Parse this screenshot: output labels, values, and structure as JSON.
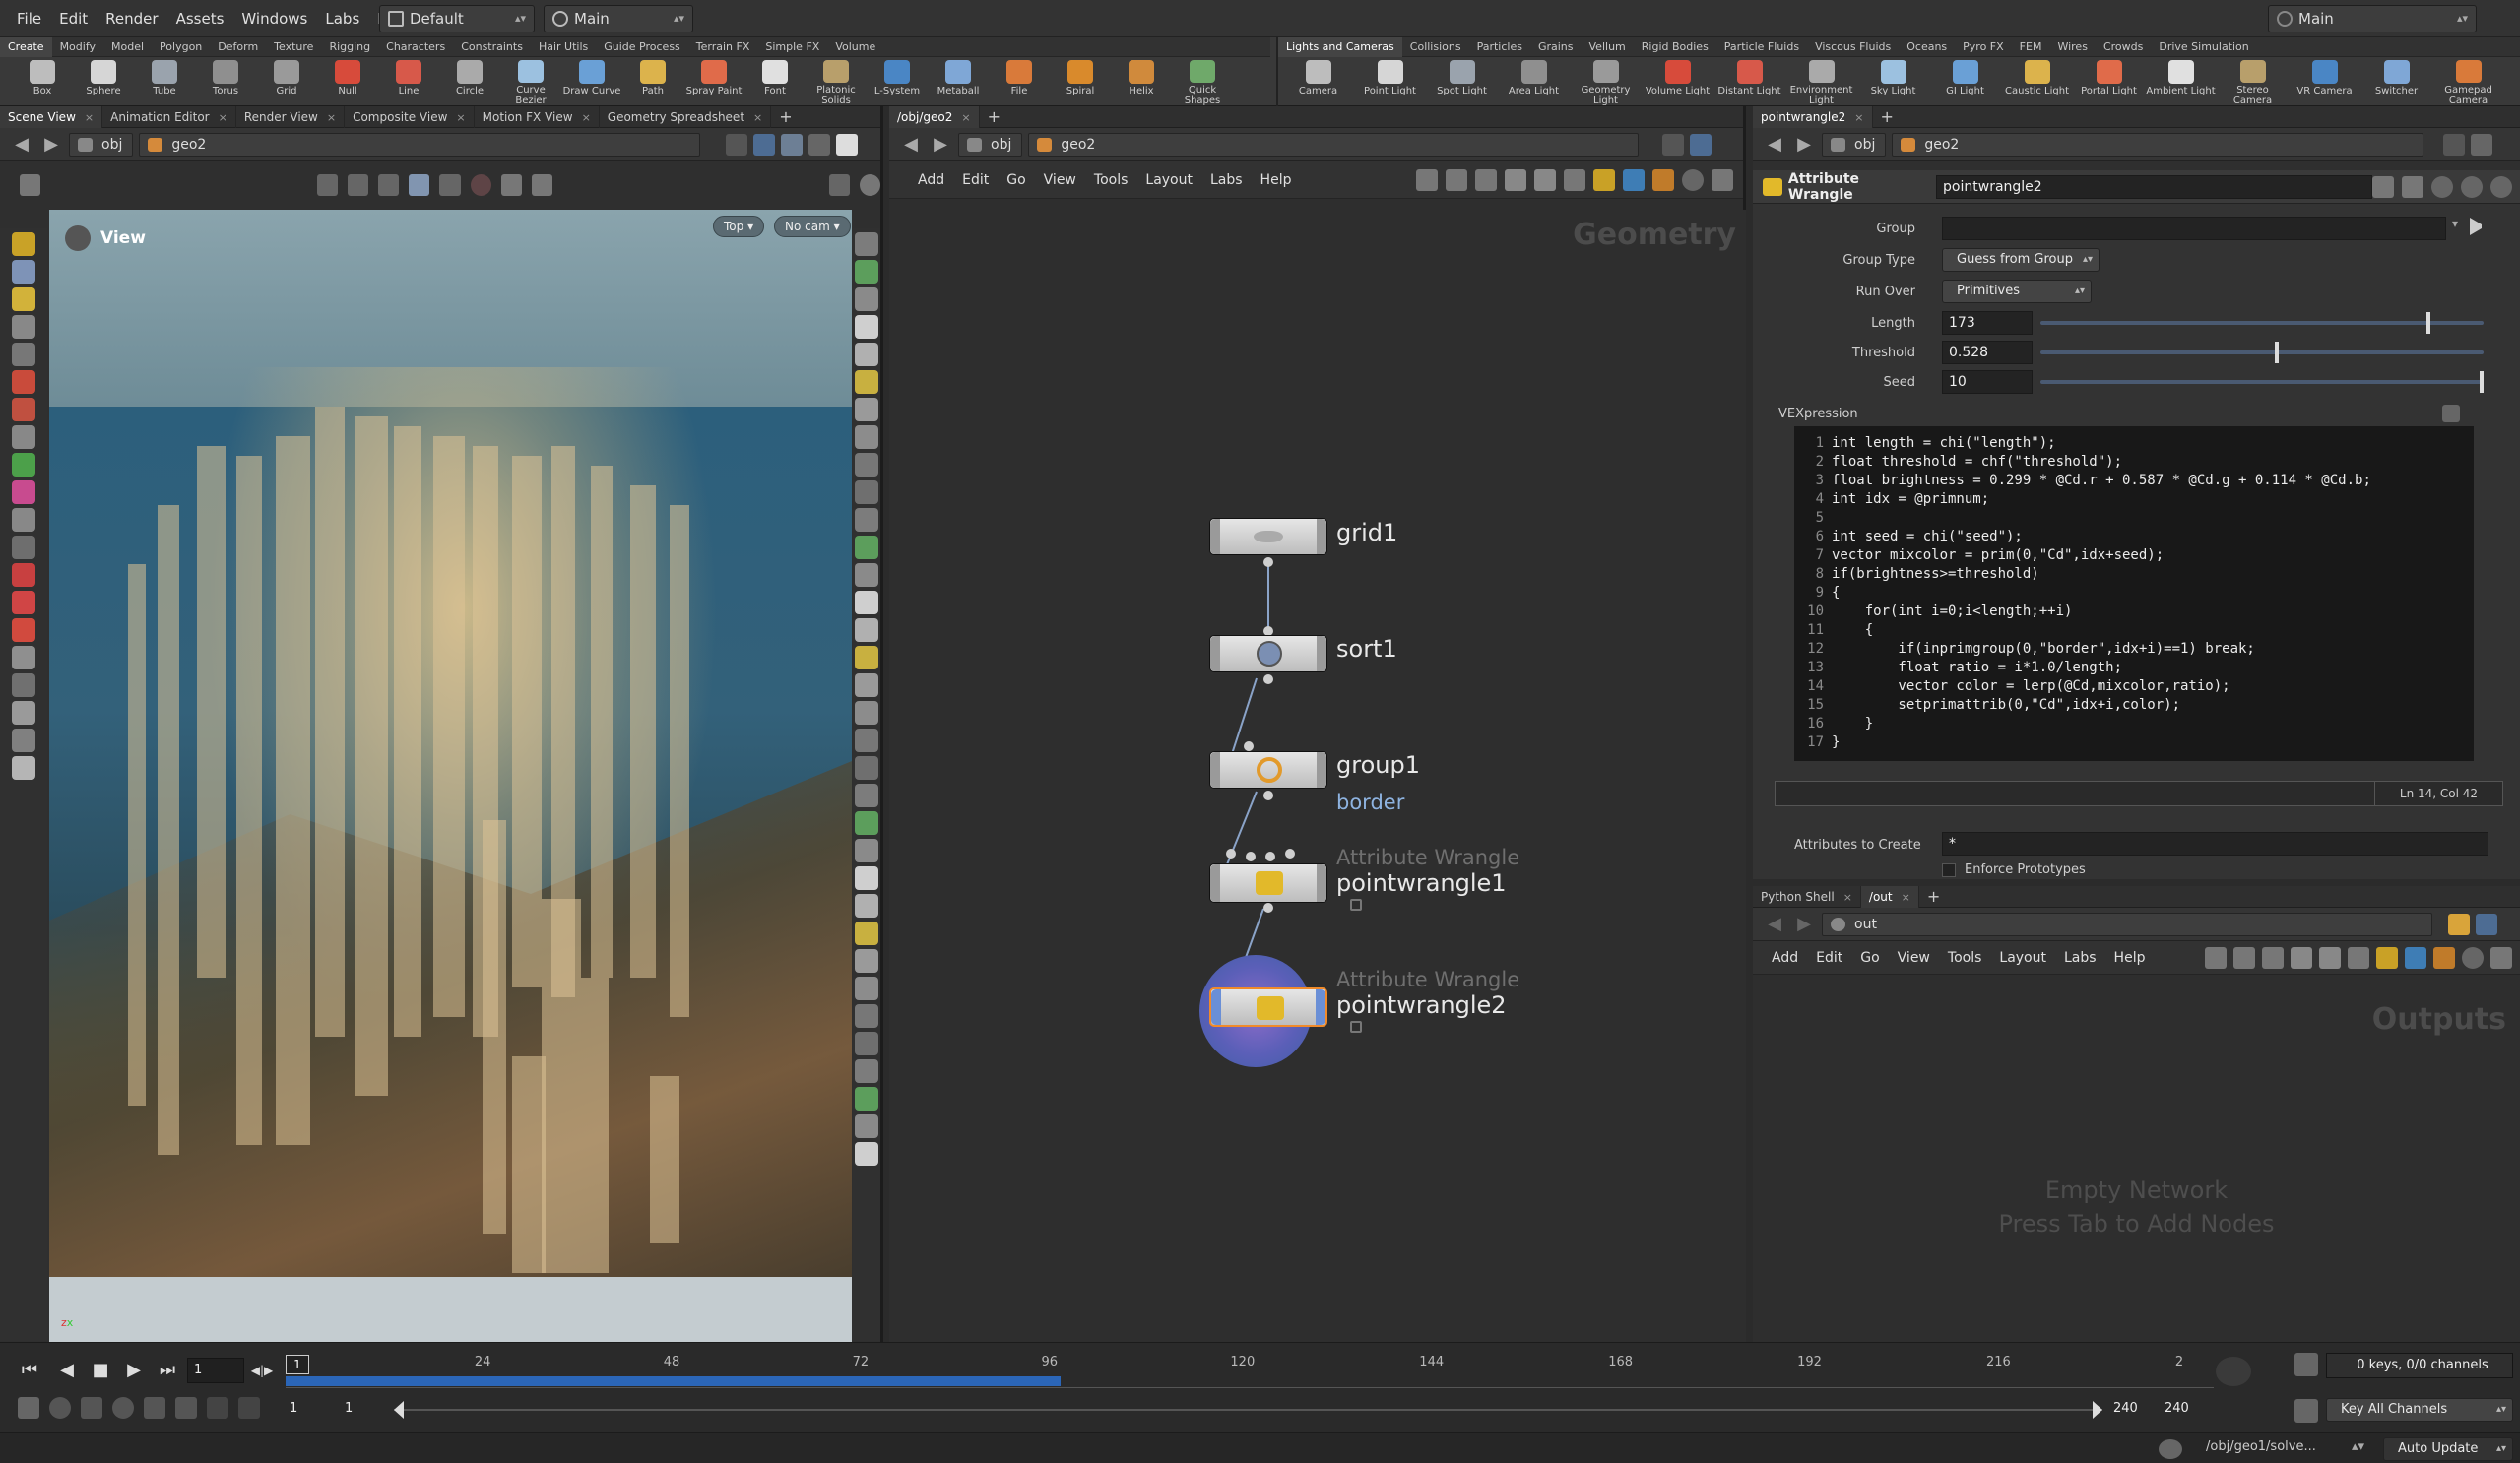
{
  "menubar": {
    "items": [
      "File",
      "Edit",
      "Render",
      "Assets",
      "Windows",
      "Labs",
      "Help"
    ],
    "desktop": "Default",
    "context": "Main",
    "right_context": "Main"
  },
  "shelf": {
    "left_tabs": [
      "Create",
      "Modify",
      "Model",
      "Polygon",
      "Deform",
      "Texture",
      "Rigging",
      "Characters",
      "Constraints",
      "Hair Utils",
      "Guide Process",
      "Terrain FX",
      "Simple FX",
      "Volume"
    ],
    "left_tools": [
      "Box",
      "Sphere",
      "Tube",
      "Torus",
      "Grid",
      "Null",
      "Line",
      "Circle",
      "Curve Bezier",
      "Draw Curve",
      "Path",
      "Spray Paint",
      "Font",
      "Platonic Solids",
      "L-System",
      "Metaball",
      "File",
      "Spiral",
      "Helix",
      "Quick Shapes"
    ],
    "right_tabs": [
      "Lights and Cameras",
      "Collisions",
      "Particles",
      "Grains",
      "Vellum",
      "Rigid Bodies",
      "Particle Fluids",
      "Viscous Fluids",
      "Oceans",
      "Pyro FX",
      "FEM",
      "Wires",
      "Crowds",
      "Drive Simulation"
    ],
    "right_tools": [
      "Camera",
      "Point Light",
      "Spot Light",
      "Area Light",
      "Geometry Light",
      "Volume Light",
      "Distant Light",
      "Environment Light",
      "Sky Light",
      "GI Light",
      "Caustic Light",
      "Portal Light",
      "Ambient Light",
      "Stereo Camera",
      "VR Camera",
      "Switcher",
      "Gamepad Camera"
    ]
  },
  "left_pane": {
    "tabs": [
      "Scene View",
      "Animation Editor",
      "Render View",
      "Composite View",
      "Motion FX View",
      "Geometry Spreadsheet"
    ],
    "path": [
      "obj",
      "geo2"
    ],
    "view_label": "View",
    "view_mode": "Top",
    "camera": "No cam"
  },
  "network_pane": {
    "tab": "/obj/geo2",
    "path": [
      "obj",
      "geo2"
    ],
    "menu": [
      "Add",
      "Edit",
      "Go",
      "View",
      "Tools",
      "Layout",
      "Labs",
      "Help"
    ],
    "context_label": "Geometry",
    "nodes": [
      {
        "name": "grid1",
        "type": "",
        "sub": ""
      },
      {
        "name": "sort1",
        "type": "",
        "sub": ""
      },
      {
        "name": "group1",
        "type": "",
        "sub": "border"
      },
      {
        "name": "pointwrangle1",
        "type": "Attribute Wrangle",
        "sub": ""
      },
      {
        "name": "pointwrangle2",
        "type": "Attribute Wrangle",
        "sub": ""
      }
    ]
  },
  "param_pane": {
    "tab": "pointwrangle2",
    "path": [
      "obj",
      "geo2"
    ],
    "node_type": "Attribute Wrangle",
    "node_name": "pointwrangle2",
    "group_label": "Group",
    "group_value": "",
    "group_type_label": "Group Type",
    "group_type_value": "Guess from Group",
    "run_over_label": "Run Over",
    "run_over_value": "Primitives",
    "length_label": "Length",
    "length_value": "173",
    "length_level": 0.87,
    "threshold_label": "Threshold",
    "threshold_value": "0.528",
    "threshold_level": 0.528,
    "seed_label": "Seed",
    "seed_value": "10",
    "seed_level": 1.0,
    "vex_label": "VEXpression",
    "code": [
      "int length = chi(\"length\");",
      "float threshold = chf(\"threshold\");",
      "float brightness = 0.299 * @Cd.r + 0.587 * @Cd.g + 0.114 * @Cd.b;",
      "int idx = @primnum;",
      "",
      "int seed = chi(\"seed\");",
      "vector mixcolor = prim(0,\"Cd\",idx+seed);",
      "if(brightness>=threshold)",
      "{",
      "    for(int i=0;i<length;++i)",
      "    {",
      "        if(inprimgroup(0,\"border\",idx+i)==1) break;",
      "        float ratio = i*1.0/length;",
      "        vector color = lerp(@Cd,mixcolor,ratio);",
      "        setprimattrib(0,\"Cd\",idx+i,color);",
      "    }",
      "}"
    ],
    "cursor_pos": "Ln 14, Col 42",
    "attrs_label": "Attributes to Create",
    "attrs_value": "*",
    "enforce_label": "Enforce Prototypes"
  },
  "out_pane": {
    "tabs": [
      "Python Shell",
      "/out"
    ],
    "path": "out",
    "menu": [
      "Add",
      "Edit",
      "Go",
      "View",
      "Tools",
      "Layout",
      "Labs",
      "Help"
    ],
    "context_label": "Outputs",
    "empty_line1": "Empty Network",
    "empty_line2": "Press Tab to Add Nodes"
  },
  "timeline": {
    "current_frame": "1",
    "marker": "1",
    "ticks": [
      "24",
      "48",
      "72",
      "96",
      "120",
      "144",
      "168",
      "192",
      "216",
      "2"
    ],
    "start": "1",
    "start2": "1",
    "end": "240",
    "end2": "240",
    "keys_status": "0 keys, 0/0 channels",
    "key_mode": "Key All Channels",
    "status_path": "/obj/geo1/solve...",
    "update_mode": "Auto Update",
    "cache_fraction": 0.41
  },
  "colors": {
    "accent_blue": "#2b66b8",
    "wire": "#8aa3c8",
    "selected_node": "#4e6fb8",
    "code_bg": "#181818"
  }
}
